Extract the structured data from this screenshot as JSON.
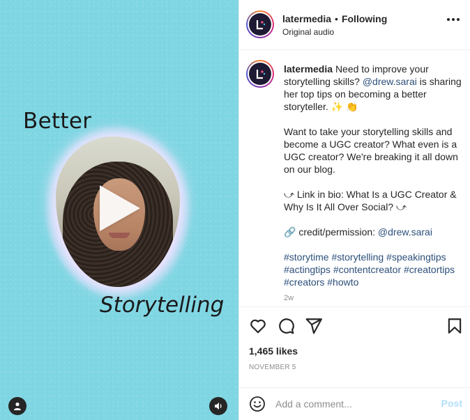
{
  "video": {
    "text_top": "Better",
    "text_bottom": "Storytelling",
    "icons": [
      "play-icon",
      "user-tag-icon",
      "audio-icon"
    ]
  },
  "header": {
    "username": "latermedia",
    "separator": "•",
    "follow_status": "Following",
    "audio_label": "Original audio"
  },
  "caption": {
    "username": "latermedia",
    "para1_text": "Need to improve your storytelling skills?",
    "para1_mention": "@drew.sarai",
    "para1_rest": "is sharing her top tips on becoming a better storyteller. ✨ 👏",
    "para2": "Want to take your storytelling skills and become a UGC creator? What even is a UGC creator? We're breaking it all down on our blog.",
    "para3": "⤻ Link in bio: What Is a UGC Creator & Why Is It All Over Social? ⤻",
    "para4_text": "🔗 credit/permission:",
    "para4_mention": "@drew.sarai",
    "hashtags": "#storytime #storytelling #speakingtips #actingtips #contentcreator #creatortips #creators #howto",
    "time_ago": "2w"
  },
  "actions": {
    "icons": [
      "heart-icon",
      "comment-icon",
      "share-icon",
      "bookmark-icon"
    ],
    "likes": "1,465 likes",
    "date": "NOVEMBER 5"
  },
  "comment": {
    "placeholder": "Add a comment...",
    "post_label": "Post"
  },
  "colors": {
    "video_bg": "#7fd6e3",
    "link": "#2c4f7a",
    "post_button": "#b2dffc",
    "secondary_text": "#8e8e8e"
  }
}
